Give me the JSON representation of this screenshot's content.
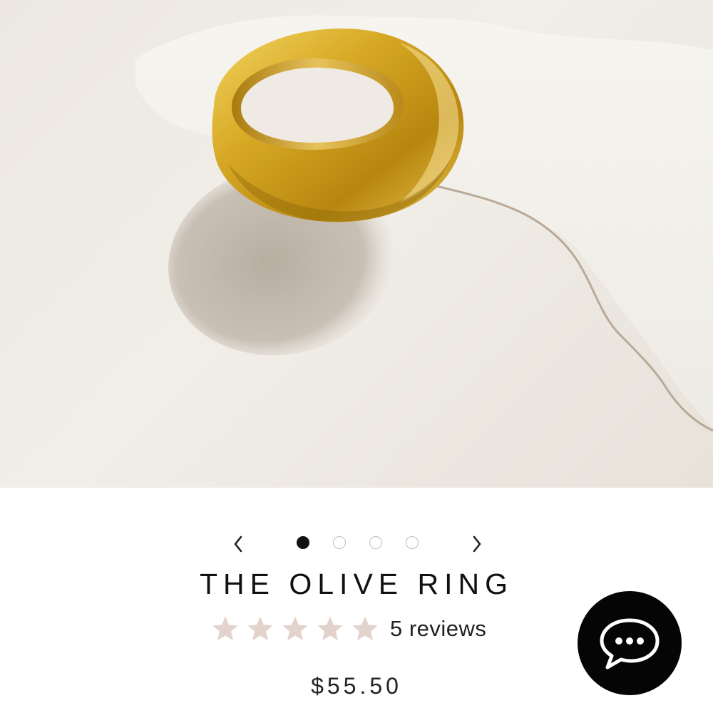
{
  "product": {
    "title": "THE OLIVE RING",
    "reviews_label": "5 reviews",
    "rating": 5,
    "rating_max": 5,
    "price": "$55.50"
  },
  "carousel": {
    "slide_count": 4,
    "active_index": 0
  },
  "icons": {
    "prev": "chevron-left-icon",
    "next": "chevron-right-icon",
    "star": "star-icon",
    "chat": "chat-bubble-icon"
  },
  "colors": {
    "star_fill": "#e3d3cd",
    "dot_active": "#111111",
    "chat_bg": "#050505",
    "ring_gold": "#d4a62a"
  }
}
